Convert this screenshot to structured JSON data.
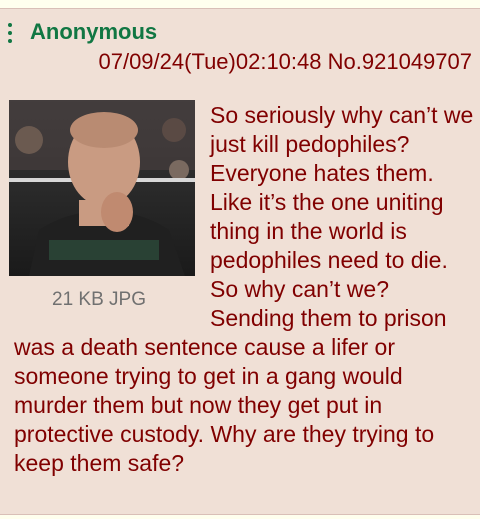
{
  "post": {
    "name": "Anonymous",
    "datetime": "07/09/24(Tue)02:10:48",
    "post_number": "No.921049707",
    "file_info": "21 KB JPG",
    "body": "So seriously why can’t we just kill pedophiles? Everyone hates them. Like it’s the one uniting thing in the world is pedophiles need to die. So why can’t we? Sending them to prison was a death sentence cause a lifer or someone trying to get in a gang would murder them but now they get put in protective custody. Why are they trying to keep them safe?"
  },
  "icons": {
    "menu": "vertical-ellipsis-icon"
  },
  "colors": {
    "name": "#117743",
    "text": "#800000",
    "post_bg": "#f0e0d6"
  }
}
